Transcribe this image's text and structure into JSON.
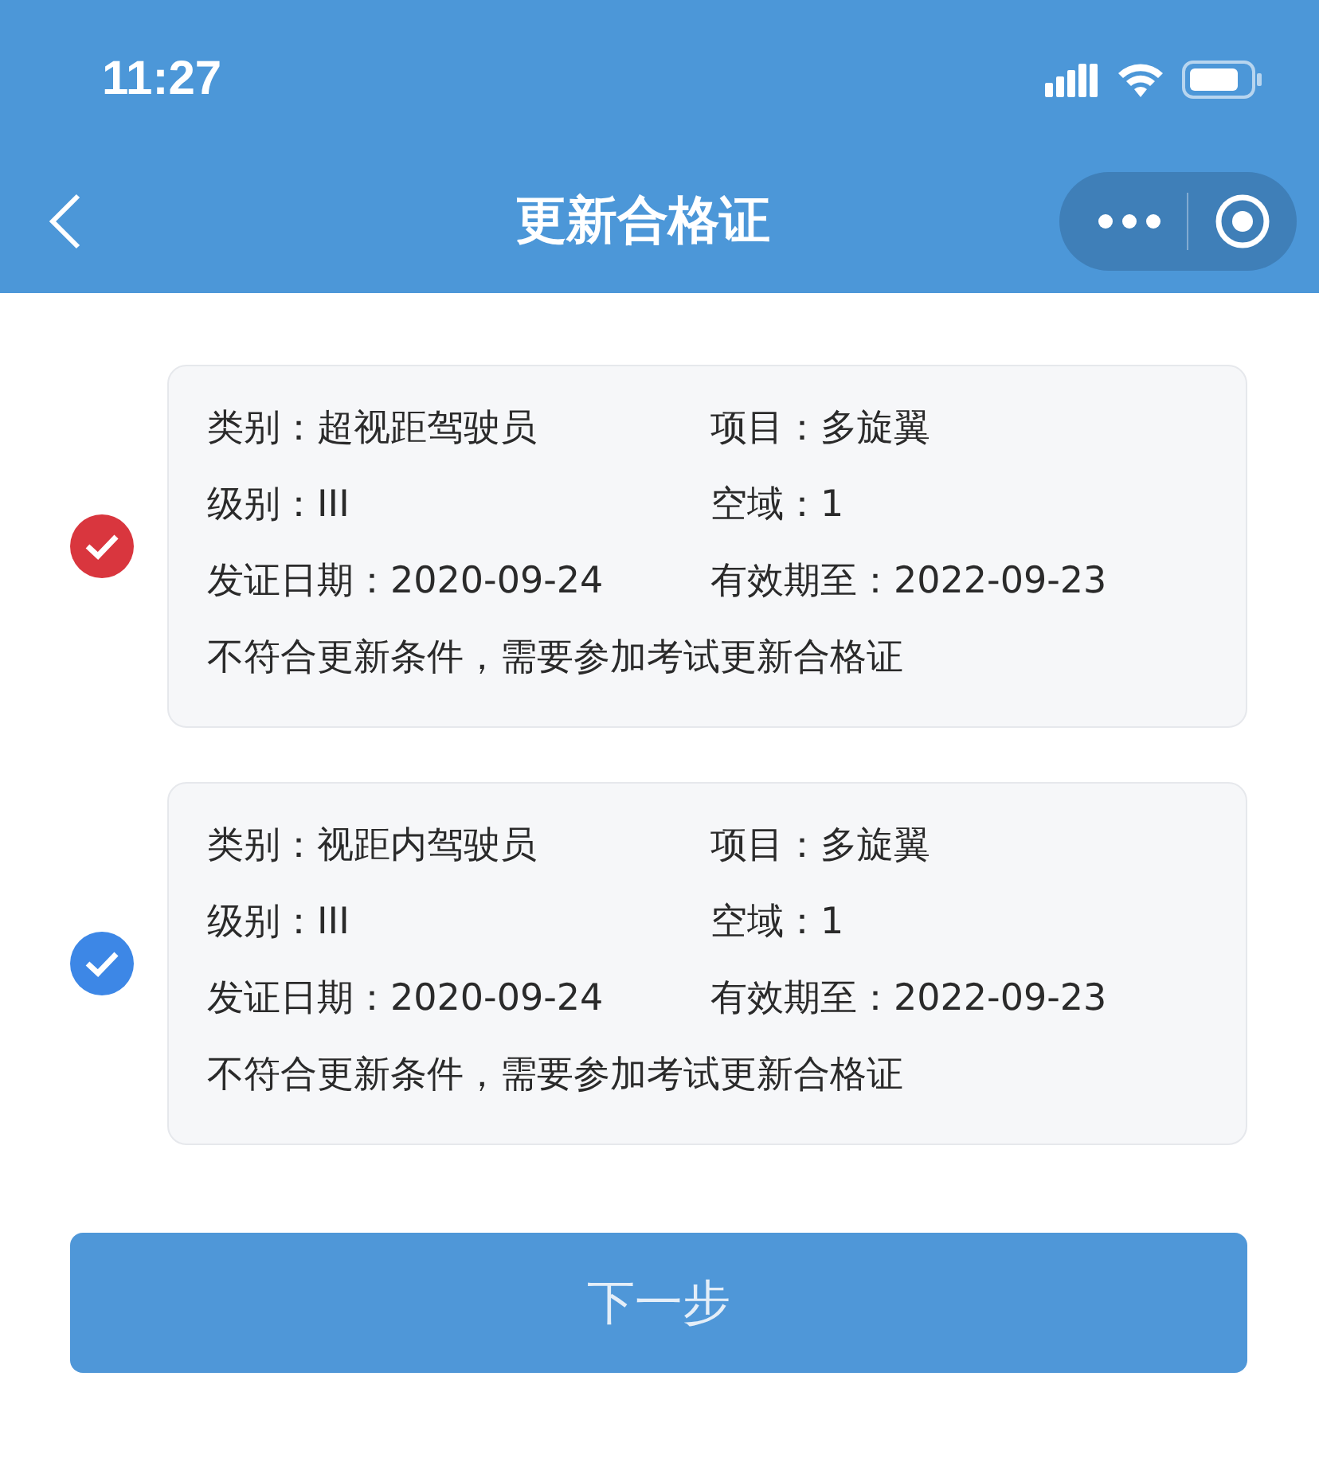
{
  "status_bar": {
    "time": "11:27"
  },
  "nav": {
    "title": "更新合格证"
  },
  "cards": [
    {
      "checked": true,
      "color": "#d9363e",
      "fields": [
        "类别：超视距驾驶员",
        "项目：多旋翼",
        "级别：III",
        "空域：1",
        "发证日期：2020-09-24",
        "有效期至：2022-09-23"
      ],
      "note": "不符合更新条件，需要参加考试更新合格证"
    },
    {
      "checked": true,
      "color": "#3d87e6",
      "fields": [
        "类别：视距内驾驶员",
        "项目：多旋翼",
        "级别：III",
        "空域：1",
        "发证日期：2020-09-24",
        "有效期至：2022-09-23"
      ],
      "note": "不符合更新条件，需要参加考试更新合格证"
    }
  ],
  "next_button": {
    "label": "下一步"
  }
}
